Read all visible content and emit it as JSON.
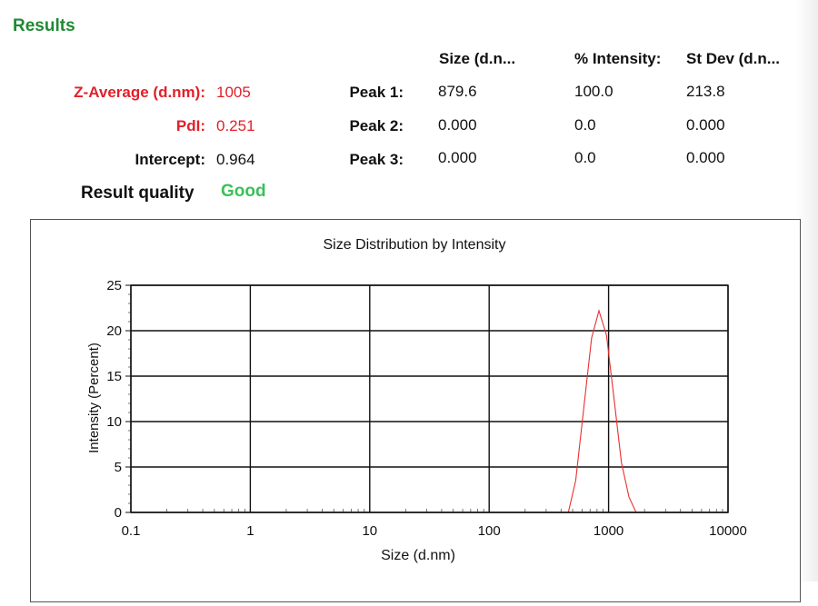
{
  "results": {
    "heading": "Results",
    "column_headers": [
      "Size (d.n...",
      "% Intensity:",
      "St Dev (d.n..."
    ],
    "z_average": {
      "label": "Z-Average (d.nm):",
      "value": "1005"
    },
    "pdi": {
      "label": "PdI:",
      "value": "0.251"
    },
    "intercept": {
      "label": "Intercept:",
      "value": "0.964"
    },
    "result_quality": {
      "label": "Result quality",
      "value": "Good"
    },
    "peaks": [
      {
        "label": "Peak 1:",
        "size": "879.6",
        "intensity": "100.0",
        "stdev": "213.8"
      },
      {
        "label": "Peak 2:",
        "size": "0.000",
        "intensity": "0.0",
        "stdev": "0.000"
      },
      {
        "label": "Peak 3:",
        "size": "0.000",
        "intensity": "0.0",
        "stdev": "0.000"
      }
    ]
  },
  "colors": {
    "heading": "#1f8a34",
    "red_label": "#e2202a",
    "good": "#3cc05a",
    "series": "#e8312e"
  },
  "chart_data": {
    "type": "line",
    "title": "Size Distribution by Intensity",
    "xlabel": "Size (d.nm)",
    "ylabel": "Intensity (Percent)",
    "x_scale": "log",
    "xlim": [
      0.1,
      10000
    ],
    "ylim": [
      0,
      25
    ],
    "x_ticks": [
      "0.1",
      "1",
      "10",
      "100",
      "1000",
      "10000"
    ],
    "y_ticks": [
      "0",
      "5",
      "10",
      "15",
      "20",
      "25"
    ],
    "grid": true,
    "series": [
      {
        "x": [
          0.4,
          1,
          10,
          100,
          300,
          460,
          530,
          620,
          720,
          830,
          960,
          1110,
          1280,
          1480,
          1700,
          10000
        ],
        "y": [
          0,
          0,
          0,
          0,
          0,
          0,
          3.5,
          11.5,
          19.2,
          22.2,
          19.5,
          12.5,
          5.5,
          1.7,
          0,
          0
        ]
      }
    ]
  }
}
